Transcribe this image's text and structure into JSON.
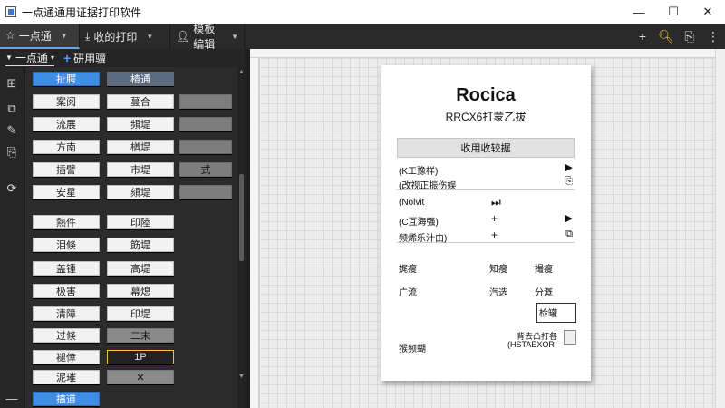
{
  "window": {
    "title": "一点通通用证据打印软件",
    "minimize": "—",
    "maximize": "☐",
    "close": "✕"
  },
  "toolbar": {
    "items": [
      {
        "label": "一点通"
      },
      {
        "label": "收的打印"
      },
      {
        "label": "模板编辑"
      }
    ]
  },
  "tabstrip": {
    "tab": "一点通",
    "add": "+",
    "add_label": "研用骥"
  },
  "palette": {
    "buttons": [
      "扯腭",
      "楂通",
      "案阅",
      "蔓合",
      "流展",
      "頻堤",
      "方南",
      "楢堤",
      "插譬",
      "市堤",
      "安星",
      "頦堤",
      "熱件",
      "印陸",
      "泪倏",
      "筯堤",
      "盖锺",
      "高堤",
      "极害",
      "幕熄",
      "清障",
      "印堤",
      "过倏",
      "二末",
      "褪倖",
      "1P",
      "泥璀",
      "✕",
      "搞道"
    ],
    "side_label": "式"
  },
  "receipt": {
    "title": "Rocica",
    "subtitle": "RRCX6打蒙乙拔",
    "header": "收用收较据",
    "rows": [
      {
        "label": "(K工豫样)",
        "mid": "",
        "icon": "▶"
      },
      {
        "label": "(改视正振伤娱",
        "mid": "",
        "icon": "⎘"
      },
      {
        "label": "(Nolvit",
        "mid": "⏭",
        "icon": ""
      },
      {
        "label": "(C互海强)",
        "mid": "+",
        "icon": "▶"
      },
      {
        "label": "频烯乐汁由)",
        "mid": "+",
        "icon": "⧉"
      }
    ],
    "grid": [
      [
        "娓瘦",
        "知瘦",
        "撮瘦"
      ],
      [
        "广流",
        "汽选",
        "分溉"
      ]
    ],
    "stamp": "检罐",
    "footer_left": "猴频蝴",
    "footer_right_1": "背去凸打各",
    "footer_right_2": "(HSTAEXOR"
  }
}
